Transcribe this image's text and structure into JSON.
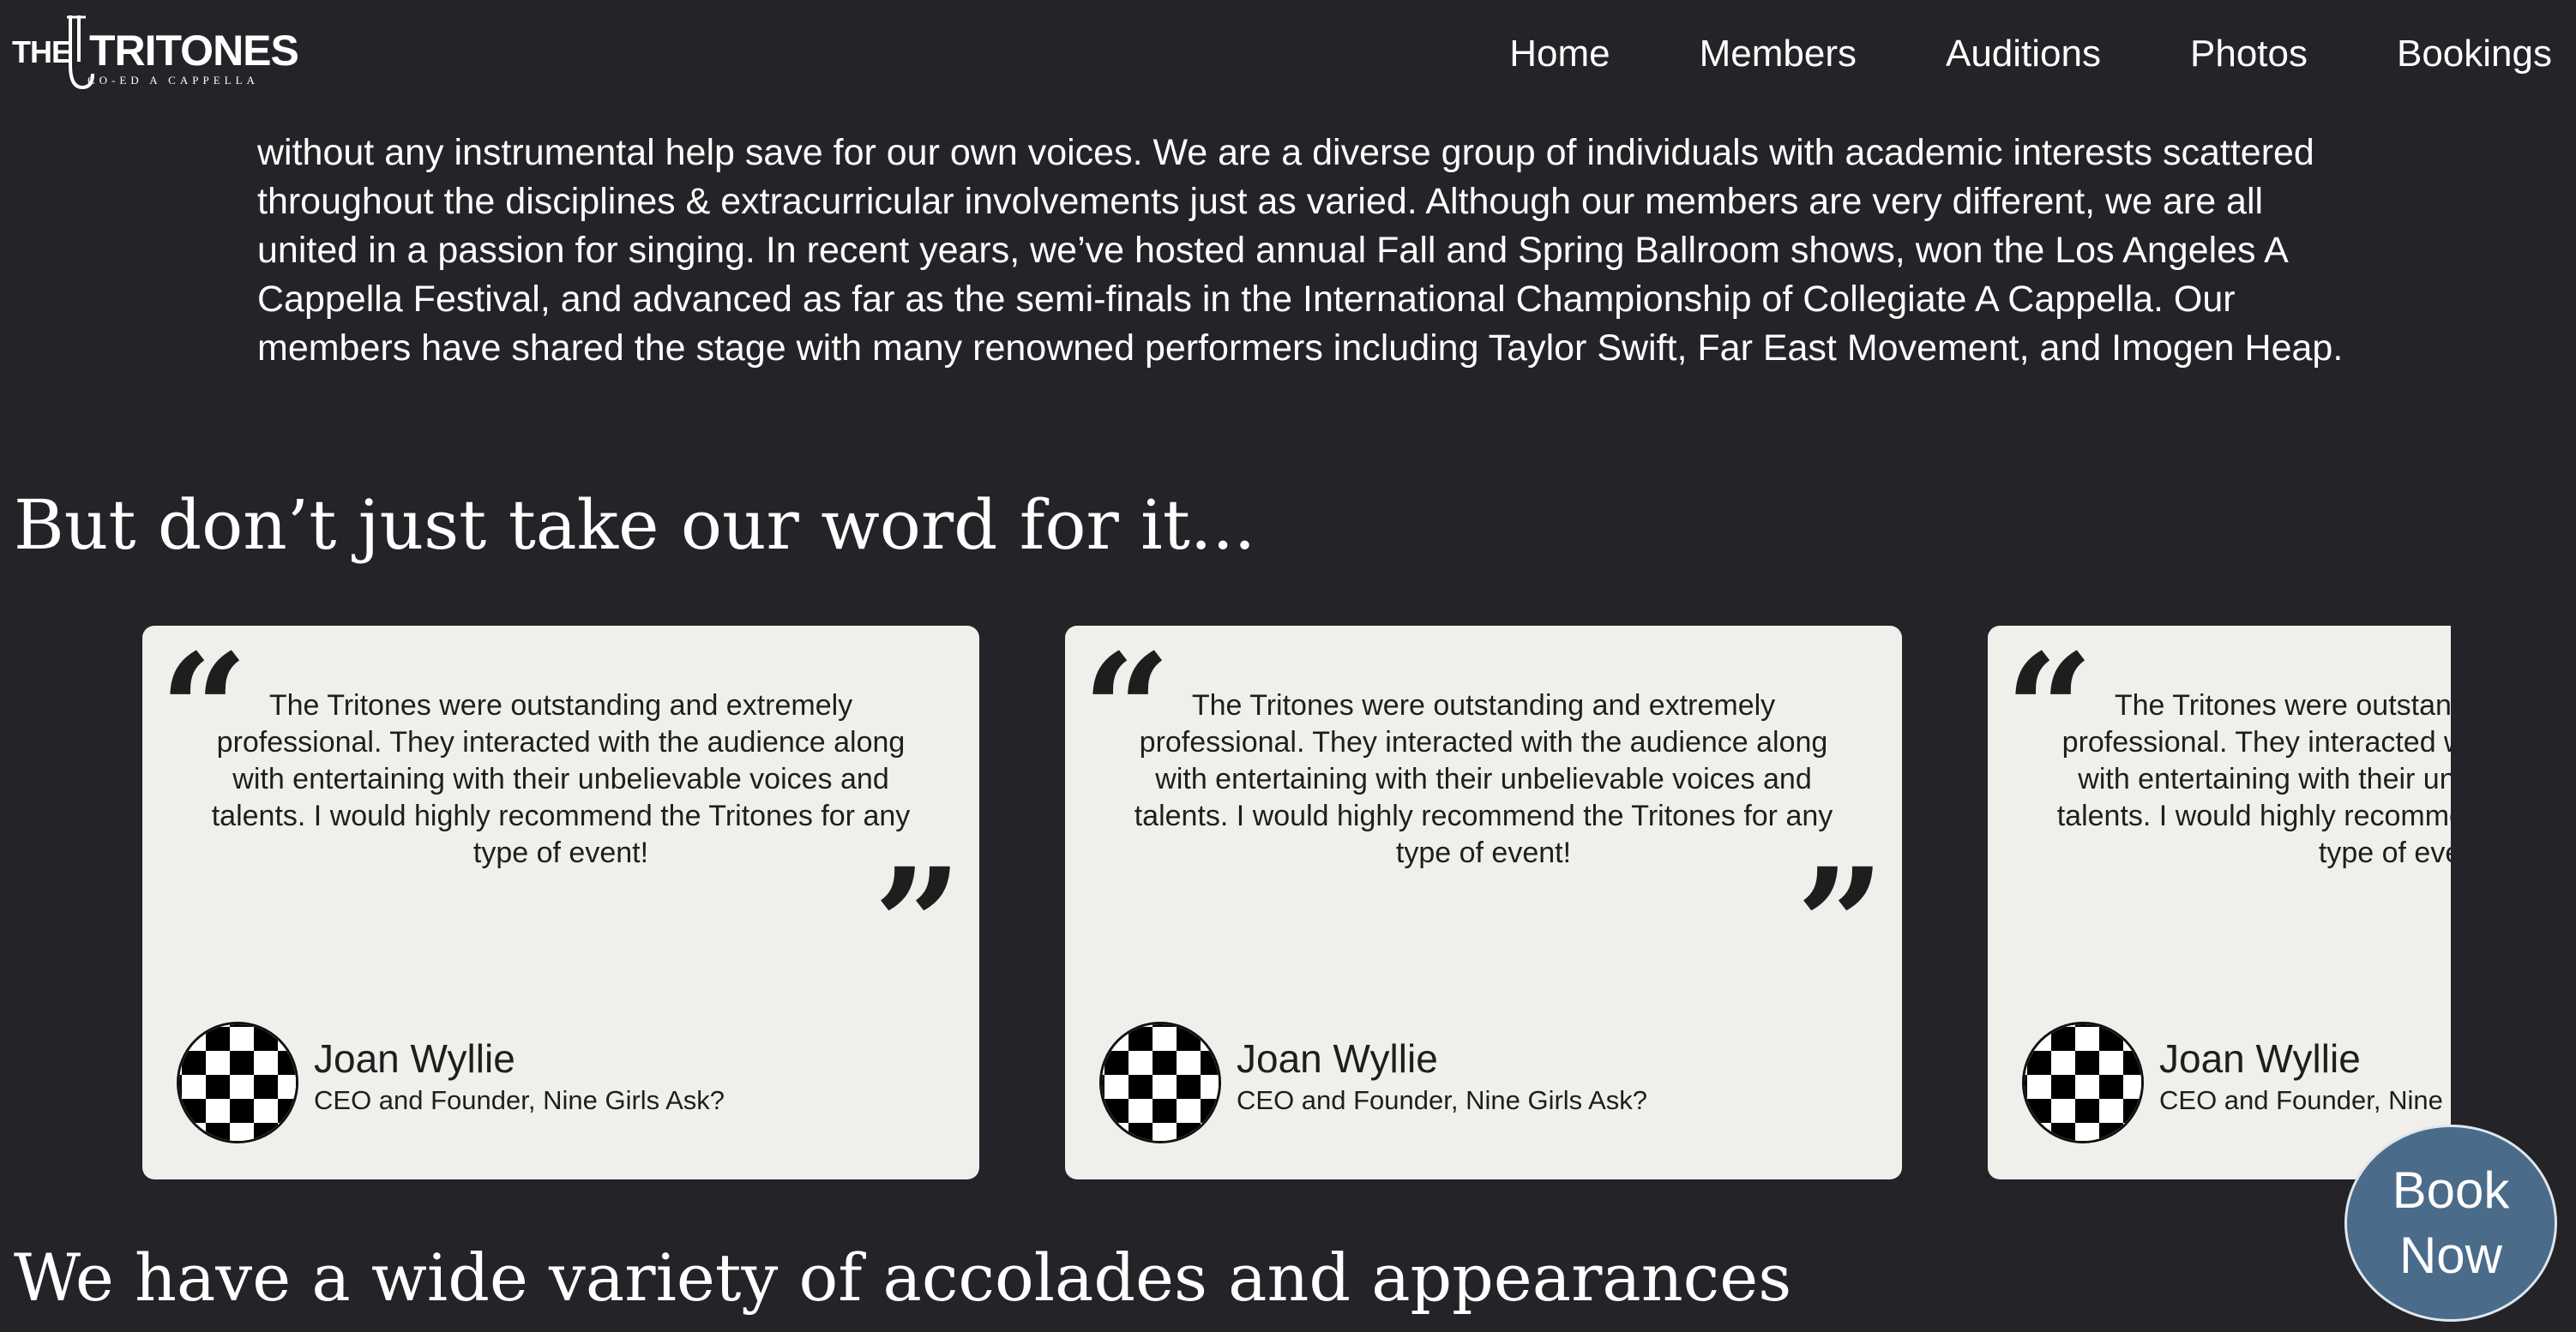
{
  "nav": {
    "logo": {
      "the": "THE",
      "name": "TRITONES",
      "sub": "CO-ED A CAPPELLA"
    },
    "links": [
      "Home",
      "Members",
      "Auditions",
      "Photos",
      "Bookings"
    ]
  },
  "intro": {
    "text": "without any instrumental help save for our own voices. We are a diverse group of individuals with academic interests scattered throughout the disciplines & extracurricular involvements just as varied. Although our members are very different, we are all united in a passion for singing. In recent years, we’ve hosted annual Fall and Spring Ballroom shows, won the Los Angeles A Cappella Festival, and advanced as far as the semi-finals in the International Championship of Collegiate A Cappella. Our members have shared the stage with many renowned performers including Taylor Swift, Far East Movement, and Imogen Heap."
  },
  "testimonials": {
    "heading": "But don’t just take our word for it...",
    "open_quote": "“",
    "close_quote": "”",
    "items": [
      {
        "quote": "The Tritones were outstanding and extremely professional. They interacted with the audience along with entertaining with their unbelievable voices and talents. I would highly recommend the Tritones for any type of event!",
        "name": "Joan Wyllie",
        "title": "CEO and Founder, Nine Girls Ask?"
      },
      {
        "quote": "The Tritones were outstanding and extremely professional. They interacted with the audience along with entertaining with their unbelievable voices and talents. I would highly recommend the Tritones for any type of event!",
        "name": "Joan Wyllie",
        "title": "CEO and Founder, Nine Girls Ask?"
      },
      {
        "quote": "The Tritones were outstanding and extremely professional. They interacted with the audience along with entertaining with their unbelievable voices and talents. I would highly recommend the Tritones for any type of event!",
        "name": "Joan Wyllie",
        "title": "CEO and Founder, Nine Girls Ask?"
      }
    ]
  },
  "accolades": {
    "heading": "We have a wide variety of accolades and appearances"
  },
  "book_now": {
    "line1": "Book",
    "line2": "Now"
  },
  "colors": {
    "background": "#242327",
    "card": "#f0efeb",
    "book_button": "#4a6b89"
  }
}
